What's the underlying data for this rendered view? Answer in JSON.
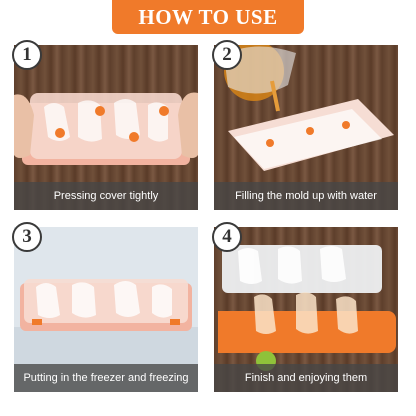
{
  "banner": {
    "title": "HOW TO USE"
  },
  "steps": [
    {
      "number": "1",
      "caption": "Pressing cover tightly"
    },
    {
      "number": "2",
      "caption": "Filling the mold up with water"
    },
    {
      "number": "3",
      "caption": "Putting in the freezer and freezing"
    },
    {
      "number": "4",
      "caption": "Finish and enjoying them"
    }
  ],
  "colors": {
    "accent": "#f07a2a",
    "tray_pink": "#f2b3a0",
    "tray_orange": "#f07a2a"
  }
}
